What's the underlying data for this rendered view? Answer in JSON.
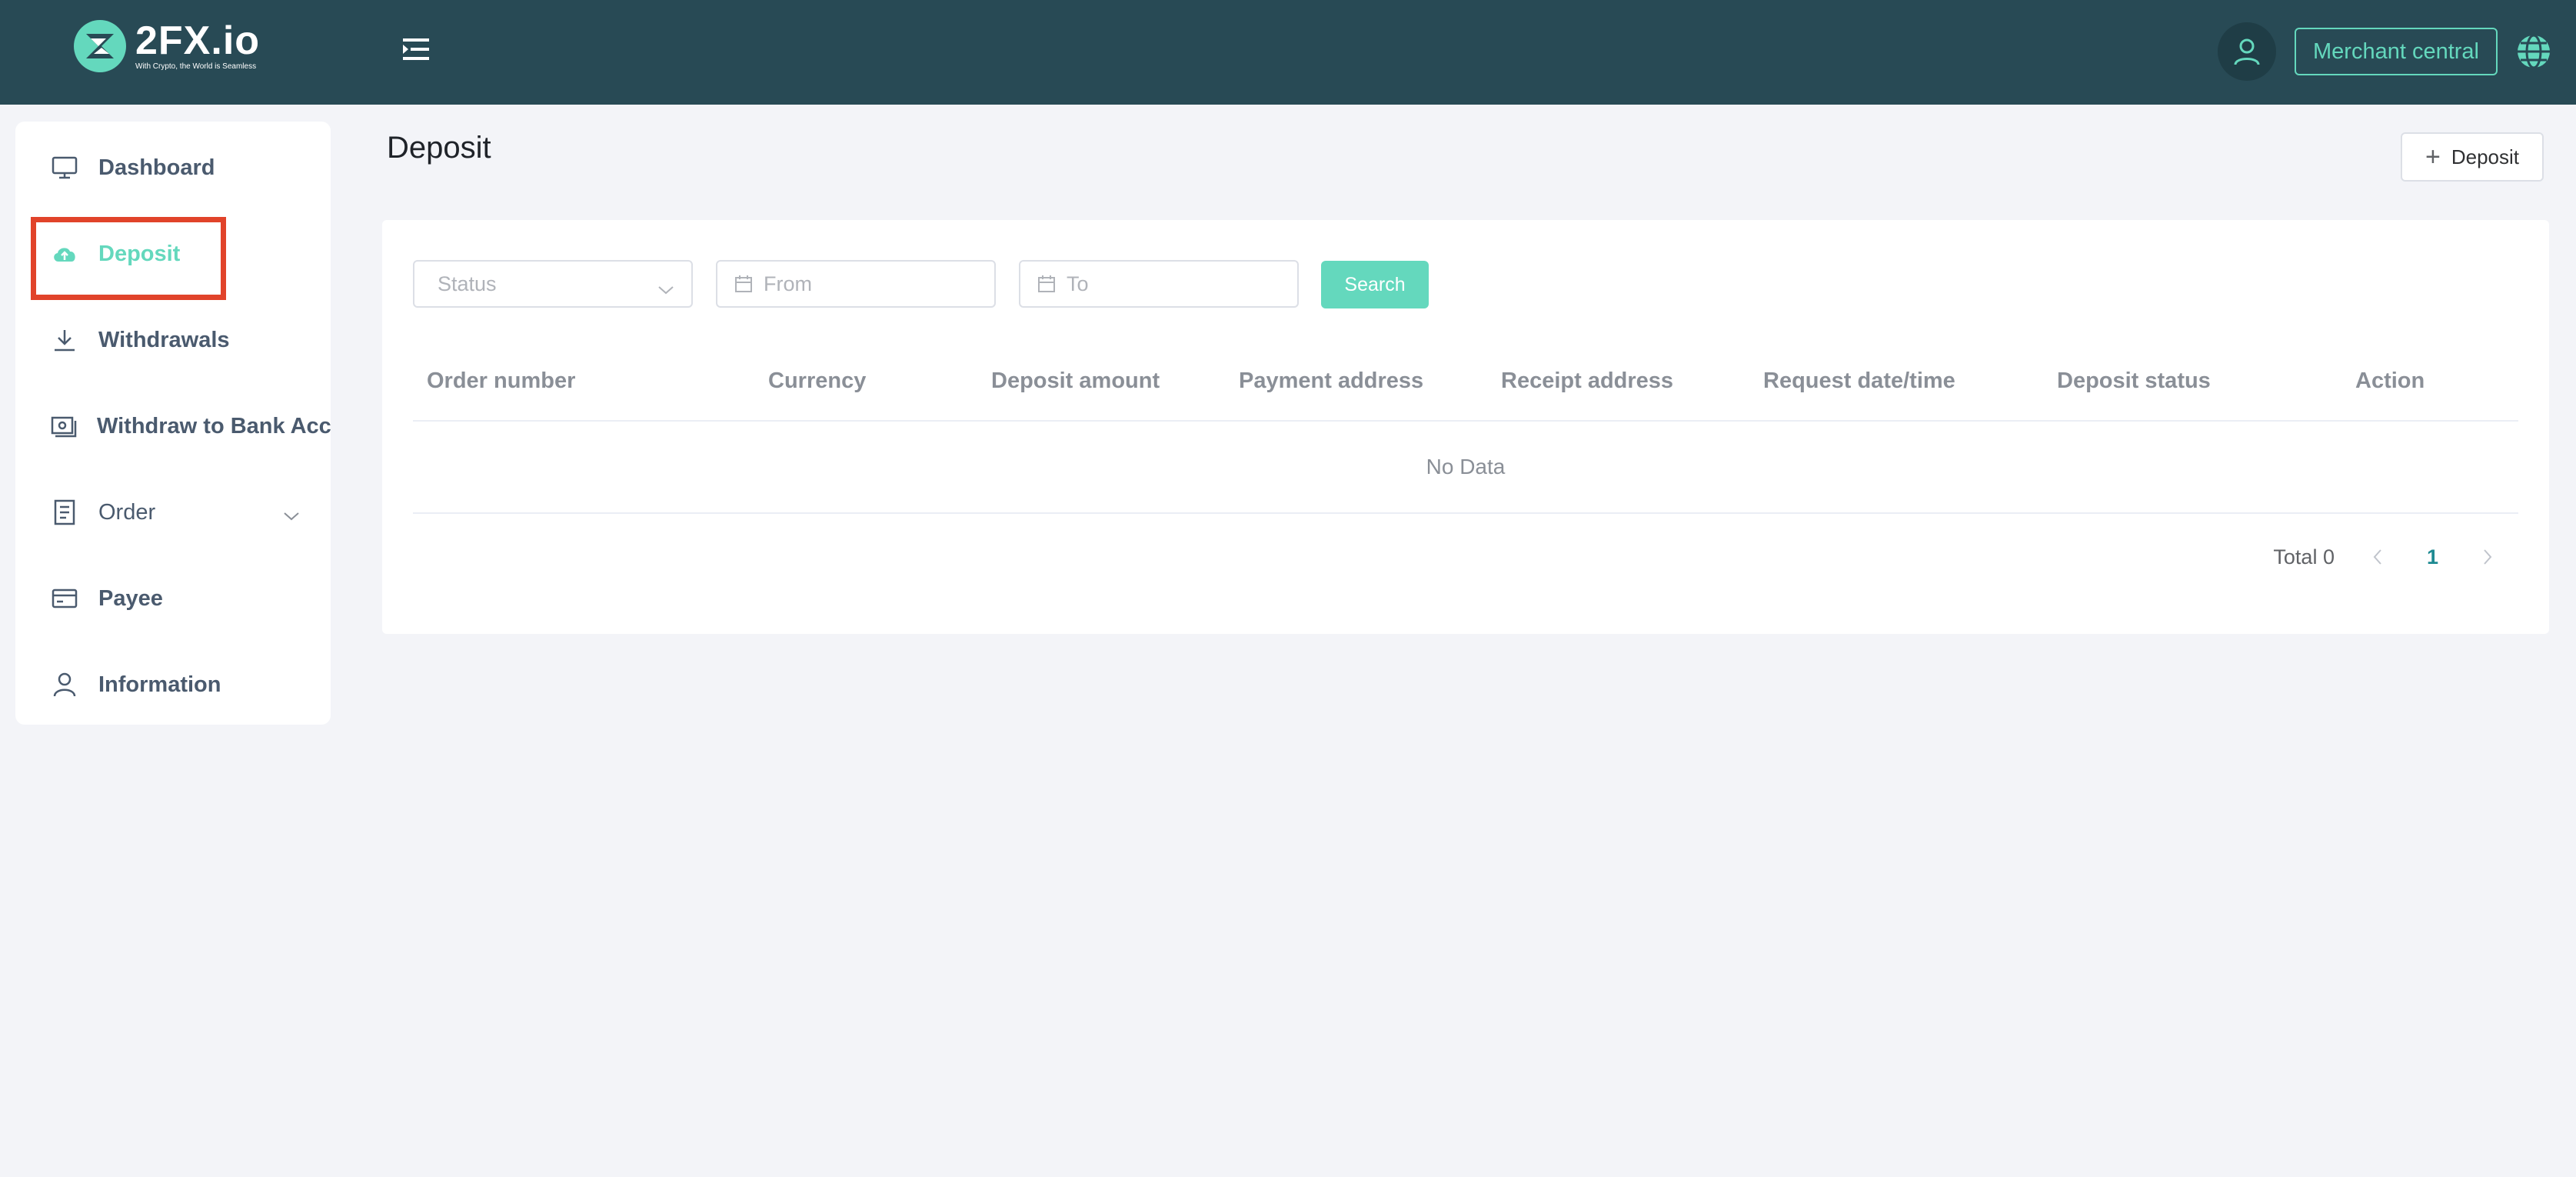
{
  "header": {
    "logo_name": "2FX.io",
    "logo_tagline": "With Crypto, the World is Seamless",
    "merchant_label": "Merchant central"
  },
  "sidebar": {
    "items": [
      {
        "label": "Dashboard",
        "icon": "monitor-icon"
      },
      {
        "label": "Deposit",
        "icon": "cloud-upload-icon",
        "active": true
      },
      {
        "label": "Withdrawals",
        "icon": "download-icon"
      },
      {
        "label": "Withdraw to Bank Account",
        "icon": "money-icon"
      },
      {
        "label": "Order",
        "icon": "document-icon",
        "expandable": true
      },
      {
        "label": "Payee",
        "icon": "credit-card-icon"
      },
      {
        "label": "Information",
        "icon": "user-icon"
      }
    ]
  },
  "main": {
    "title": "Deposit",
    "deposit_button": "Deposit",
    "filters": {
      "status_placeholder": "Status",
      "from_placeholder": "From",
      "to_placeholder": "To",
      "search_label": "Search"
    },
    "table": {
      "columns": [
        "Order number",
        "Currency",
        "Deposit amount",
        "Payment address",
        "Receipt address",
        "Request date/time",
        "Deposit status",
        "Action"
      ],
      "empty_text": "No Data"
    },
    "pagination": {
      "total_label": "Total 0",
      "current_page": "1"
    }
  },
  "colors": {
    "header_bg": "#284a55",
    "accent": "#64d8bd",
    "highlight": "#e1432a"
  }
}
